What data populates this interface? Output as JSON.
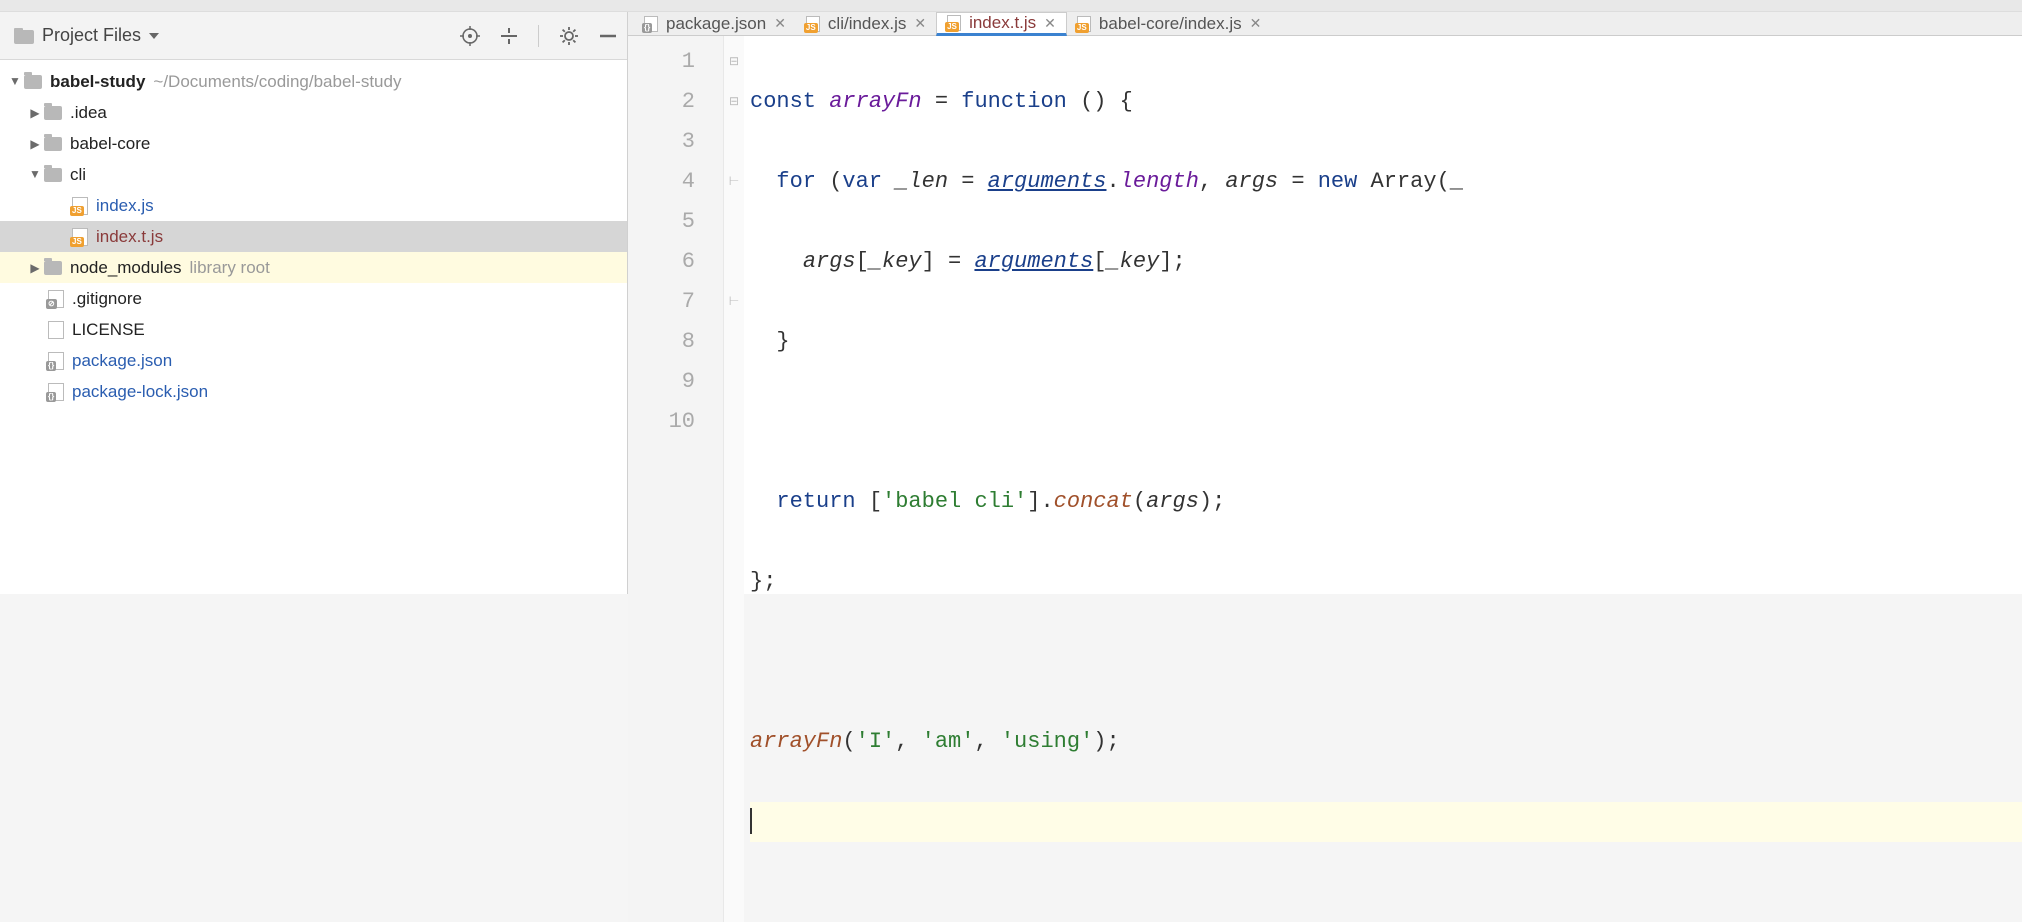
{
  "sidebar": {
    "title": "Project Files",
    "project": {
      "name": "babel-study",
      "path": "~/Documents/coding/babel-study"
    },
    "tree": {
      "idea": ".idea",
      "babel_core": "babel-core",
      "cli": "cli",
      "cli_index": "index.js",
      "cli_index_t": "index.t.js",
      "node_modules": "node_modules",
      "node_modules_sub": "library root",
      "gitignore": ".gitignore",
      "license": "LICENSE",
      "package_json": "package.json",
      "package_lock": "package-lock.json"
    }
  },
  "tabs": [
    {
      "label": "package.json",
      "type": "json",
      "active": false
    },
    {
      "label": "cli/index.js",
      "type": "js",
      "active": false
    },
    {
      "label": "index.t.js",
      "type": "js",
      "active": true
    },
    {
      "label": "babel-core/index.js",
      "type": "js",
      "active": false
    }
  ],
  "code": {
    "lines": [
      "1",
      "2",
      "3",
      "4",
      "5",
      "6",
      "7",
      "8",
      "9",
      "10"
    ],
    "tokens": {
      "const": "const",
      "arrayFn": "arrayFn",
      "eq": " = ",
      "function": "function",
      "parens": " () {",
      "for": "for",
      "var": "var",
      "len": "_len",
      "arguments": "arguments",
      "length": "length",
      "args": "args",
      "new": "new",
      "Array": "Array",
      "key": "_key",
      "closeBrace": "}",
      "return": "return",
      "str1": "'babel cli'",
      "concat": "concat",
      "endblock": "};",
      "call_i": "'I'",
      "call_am": "'am'",
      "call_using": "'using'"
    }
  }
}
